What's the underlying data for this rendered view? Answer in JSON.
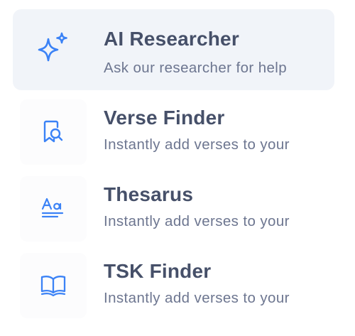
{
  "colors": {
    "accent": "#3b82f6",
    "title": "#465069",
    "subtitle": "#6d7690",
    "active_background": "#f1f4f9"
  },
  "items": [
    {
      "icon": "sparkles-icon",
      "title": "AI Researcher",
      "subtitle": "Ask our researcher for help",
      "active": true
    },
    {
      "icon": "book-search-icon",
      "title": "Verse Finder",
      "subtitle": "Instantly add verses to your",
      "active": false
    },
    {
      "icon": "text-format-icon",
      "title": "Thesarus",
      "subtitle": "Instantly add verses to your",
      "active": false
    },
    {
      "icon": "open-book-icon",
      "title": "TSK Finder",
      "subtitle": "Instantly add verses to your",
      "active": false
    }
  ]
}
